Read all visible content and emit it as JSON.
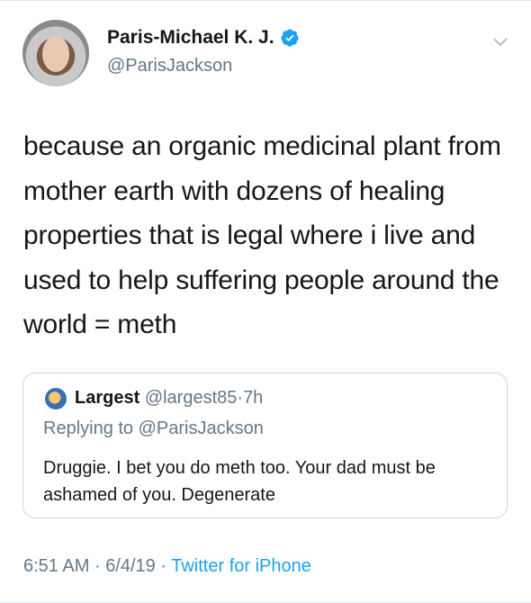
{
  "tweet": {
    "display_name": "Paris-Michael K. J.",
    "handle": "@ParisJackson",
    "text": "because an organic medicinal plant from mother earth with dozens of healing properties that is legal where i live and used to help suffering people around the world = meth",
    "time": "6:51 AM",
    "date": "6/4/19",
    "source": "Twitter for iPhone",
    "separator": "·"
  },
  "quote": {
    "display_name": "Largest",
    "handle": "@largest85",
    "separator": "·",
    "age": "7h",
    "replying_label": "Replying to",
    "replying_to": "@ParisJackson",
    "text": "Druggie. I bet you do meth too. Your dad must be ashamed of you. Degenerate"
  },
  "colors": {
    "accent": "#1da1f2",
    "secondary_text": "#657786",
    "border": "#ccd6dd"
  },
  "icons": {
    "verified": "verified-badge-icon",
    "menu": "chevron-down-icon"
  }
}
